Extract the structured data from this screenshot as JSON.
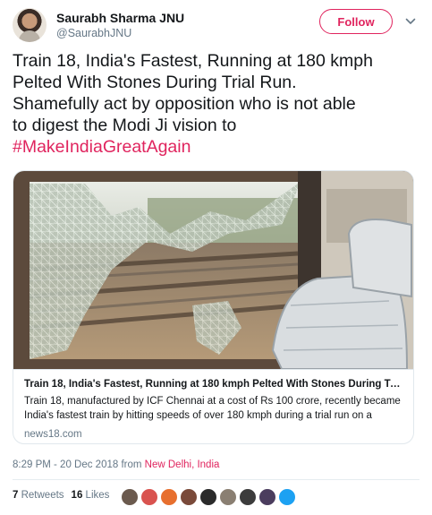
{
  "author": {
    "name": "Saurabh Sharma JNU",
    "handle": "@SaurabhJNU",
    "follow_label": "Follow"
  },
  "tweet": {
    "lines": [
      "Train 18, India's Fastest, Running at 180 kmph",
      "Pelted With Stones During Trial Run.",
      "Shamefully act by opposition who is not able",
      "to digest the Modi Ji vision to"
    ],
    "hashtag": "#MakeIndiaGreatAgain"
  },
  "card": {
    "title": "Train 18, India's Fastest, Running at 180 kmph Pelted With Stones During Tria...",
    "description": "Train 18, manufactured by ICF Chennai at a cost of Rs 100 crore, recently became India's fastest train by hitting speeds of over 180 kmph during a trial run on a section",
    "domain": "news18.com"
  },
  "meta": {
    "time": "8:29 PM - 20 Dec 2018",
    "from": "from",
    "location": "New Delhi, India"
  },
  "stats": {
    "retweets_count": "7",
    "retweets_label": "Retweets",
    "likes_count": "16",
    "likes_label": "Likes"
  },
  "likers": [
    {
      "color": "#6b5a4e"
    },
    {
      "color": "#d9534f"
    },
    {
      "color": "#e76f2e"
    },
    {
      "color": "#7a4a3a"
    },
    {
      "color": "#2b2b2b"
    },
    {
      "color": "#8a7f72"
    },
    {
      "color": "#3c3c3c"
    },
    {
      "color": "#4b3d5e"
    },
    {
      "color": "#1da1f2"
    }
  ],
  "colors": {
    "accent": "#e0245e",
    "secondary_text": "#657786",
    "text": "#14171a"
  }
}
